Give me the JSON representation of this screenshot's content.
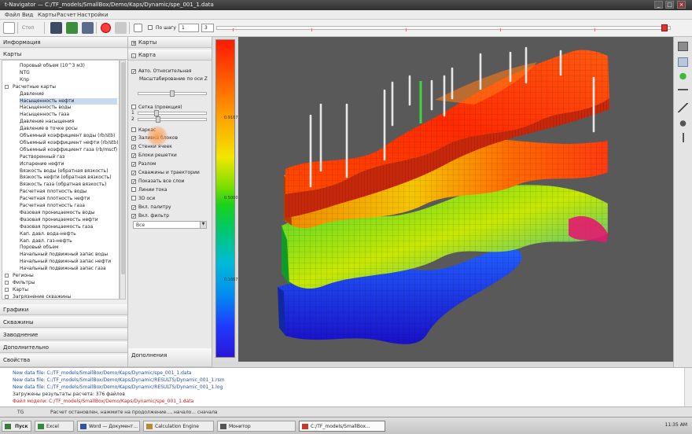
{
  "window": {
    "title": "t-Navigator — C:/TF_models/SmallBox/Demo/Kaps/Dynamic/spe_001_1.data"
  },
  "menu": [
    "Файл",
    "Вид",
    "Карты",
    "Расчет",
    "Настройки"
  ],
  "toolbar": {
    "stop_label": "Стоп",
    "step_check_label": "По шагу",
    "step_value": "1",
    "frame_value": "3",
    "icons": [
      "new-icon",
      "open-icon",
      "save-icon",
      "export-icon",
      "refresh-icon",
      "record-icon",
      "settings-icon"
    ]
  },
  "left_panel": {
    "header": "Информация",
    "subheader": "Карты",
    "tree": [
      {
        "label": "Поровый объем (10^3 м3)",
        "level": 2
      },
      {
        "label": "NTG",
        "level": 2
      },
      {
        "label": "Кпр",
        "level": 2
      },
      {
        "label": "Расчетные карты",
        "level": 1,
        "toggle": "-"
      },
      {
        "label": "Давление",
        "level": 2
      },
      {
        "label": "Насыщенность нефти",
        "level": 2,
        "selected": true
      },
      {
        "label": "Насыщенность воды",
        "level": 2
      },
      {
        "label": "Насыщенность газа",
        "level": 2
      },
      {
        "label": "Давление насыщения",
        "level": 2
      },
      {
        "label": "Давление в точке росы",
        "level": 2
      },
      {
        "label": "Объемный коэффициент воды (rb/stb)",
        "level": 2
      },
      {
        "label": "Объемный коэффициент нефти (rb/stb)",
        "level": 2
      },
      {
        "label": "Объемный коэффициент газа (rb/mscf)",
        "level": 2
      },
      {
        "label": "Растворенный газ",
        "level": 2
      },
      {
        "label": "Испарение нефти",
        "level": 2
      },
      {
        "label": "Вязкость воды (обратная вязкость)",
        "level": 2
      },
      {
        "label": "Вязкость нефти (обратная вязкость)",
        "level": 2
      },
      {
        "label": "Вязкость газа (обратная вязкость)",
        "level": 2
      },
      {
        "label": "Расчетная плотность воды",
        "level": 2
      },
      {
        "label": "Расчетная плотность нефти",
        "level": 2
      },
      {
        "label": "Расчетная плотность газа",
        "level": 2
      },
      {
        "label": "Фазовая проницаемость воды",
        "level": 2
      },
      {
        "label": "Фазовая проницаемость нефти",
        "level": 2
      },
      {
        "label": "Фазовая проницаемость газа",
        "level": 2
      },
      {
        "label": "Кап. давл. вода-нефть",
        "level": 2
      },
      {
        "label": "Кап. давл. газ-нефть",
        "level": 2
      },
      {
        "label": "Поровый объем",
        "level": 2
      },
      {
        "label": "Начальный подвижный запас воды",
        "level": 2
      },
      {
        "label": "Начальный подвижный запас нефти",
        "level": 2
      },
      {
        "label": "Начальный подвижный запас газа",
        "level": 2
      },
      {
        "label": "Регионы",
        "level": 0,
        "toggle": "+"
      },
      {
        "label": "Фильтры",
        "level": 0,
        "toggle": "+"
      },
      {
        "label": "Карты",
        "level": 0,
        "toggle": "+"
      },
      {
        "label": "Загрязнение скважины",
        "level": 0,
        "toggle": "+"
      }
    ],
    "sections": [
      "Графики",
      "Скважины",
      "Заводнение",
      "Дополнительно",
      "Свойства"
    ]
  },
  "mid_panel": {
    "header_top": "Карты",
    "header_second": "Карта",
    "items": [
      {
        "label": "Авто. Относительная",
        "checked": true
      },
      {
        "label": "Масштабирование по оси Z",
        "checked": false
      },
      {
        "label": "Сетка (проекция)",
        "checked": false
      },
      {
        "label": "Каркас",
        "checked": false
      },
      {
        "label": "Заливка блоков",
        "checked": true
      },
      {
        "label": "Стенки ячеек",
        "checked": true
      },
      {
        "label": "Блоки решетки",
        "checked": true
      },
      {
        "label": "Разлом",
        "checked": true
      },
      {
        "label": "Скважины и траектории",
        "checked": true
      },
      {
        "label": "Показать все слои",
        "checked": true
      },
      {
        "label": "Линии тока",
        "checked": false
      },
      {
        "label": "3D оси",
        "checked": false
      },
      {
        "label": "Вкл. палитру",
        "checked": true
      },
      {
        "label": "Вкл. фильтр",
        "checked": true
      }
    ],
    "slider_1_label": "1",
    "slider_2_label": "2",
    "select_value": "Все",
    "footer": "Дополнения"
  },
  "colorbar": {
    "max": "",
    "labels": [
      {
        "text": "0.9167"
      },
      {
        "text": "0.5000"
      },
      {
        "text": "0.1667"
      }
    ]
  },
  "viewport": {
    "description": "3D reservoir model colored by oil saturation"
  },
  "log": [
    {
      "text": "New data file: C:/TF_models/SmallBox/Demo/Kaps/Dynamic/spe_001_1.data",
      "color": "#2a4fb0"
    },
    {
      "text": "New data file: C:/TF_models/SmallBox/Demo/Kaps/Dynamic/RESULTS/Dynamic_001_1.rsm",
      "color": "#2a4fb0"
    },
    {
      "text": "New data file: C:/TF_models/SmallBox/Demo/Kaps/Dynamic/RESULTS/Dynamic_001_1.log",
      "color": "#2a4fb0"
    },
    {
      "text": "Загружены результаты расчета: 376 файлов",
      "color": "#2b2b2b"
    },
    {
      "text": "Файл модели: C:/TF_models/SmallBox/Demo/Kaps/Dynamic/spe_001_1.data",
      "color": "#c22121"
    }
  ],
  "status": {
    "left": "TG",
    "message": "Расчет остановлен, нажмите на продолжение..., начало... сначала"
  },
  "taskbar": {
    "start": "Пуск",
    "tasks": [
      {
        "label": "Excel",
        "active": false
      },
      {
        "label": "Word — Документ...",
        "active": false
      },
      {
        "label": "Calculation Engine",
        "active": false
      },
      {
        "label": "Монитор",
        "active": false
      },
      {
        "label": "C:/TF_models/SmallBox...",
        "active": true
      }
    ],
    "clock": "11:35 AM"
  }
}
